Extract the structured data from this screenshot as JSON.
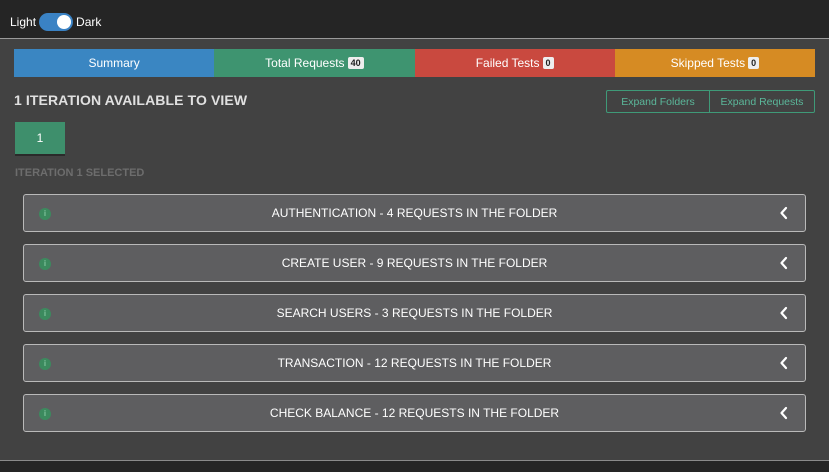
{
  "theme": {
    "light_label": "Light",
    "dark_label": "Dark",
    "dark_enabled": true
  },
  "tabs": [
    {
      "label": "Summary",
      "badge": "",
      "color": "#3a86c2"
    },
    {
      "label": "Total Requests",
      "badge": "40",
      "color": "#3e9470"
    },
    {
      "label": "Failed Tests",
      "badge": "0",
      "color": "#c9493f"
    },
    {
      "label": "Skipped Tests",
      "badge": "0",
      "color": "#d68b23"
    }
  ],
  "heading": "1 ITERATION AVAILABLE TO VIEW",
  "buttons": {
    "expand_folders": "Expand Folders",
    "expand_requests": "Expand Requests"
  },
  "iteration": {
    "label": "1",
    "selected_text": "ITERATION 1 SELECTED"
  },
  "folders": [
    {
      "title": "AUTHENTICATION - 4 REQUESTS IN THE FOLDER",
      "status_icon": "info-icon"
    },
    {
      "title": "CREATE USER - 9 REQUESTS IN THE FOLDER",
      "status_icon": "info-icon"
    },
    {
      "title": "SEARCH USERS - 3 REQUESTS IN THE FOLDER",
      "status_icon": "info-icon"
    },
    {
      "title": "TRANSACTION - 12 REQUESTS IN THE FOLDER",
      "status_icon": "info-icon"
    },
    {
      "title": "CHECK BALANCE - 12 REQUESTS IN THE FOLDER",
      "status_icon": "info-icon"
    }
  ]
}
